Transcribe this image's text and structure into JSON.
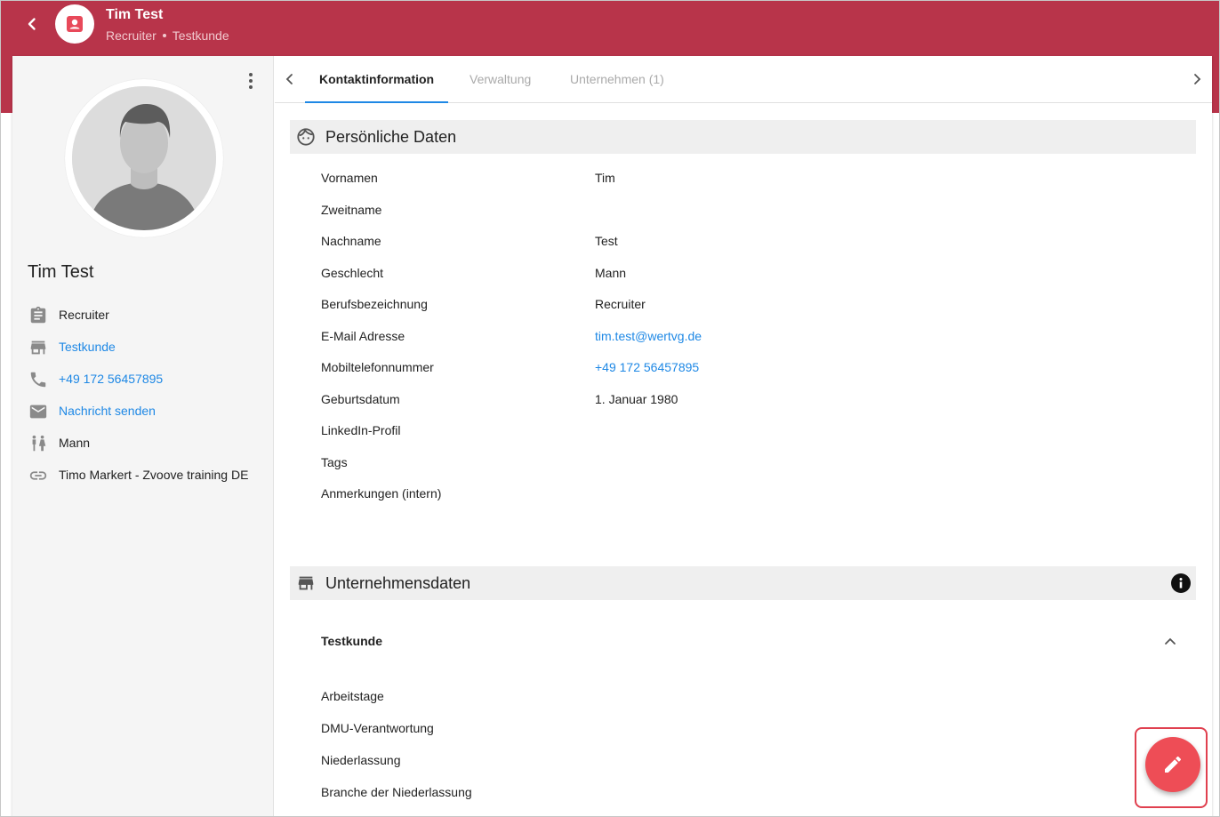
{
  "header": {
    "title": "Tim Test",
    "subtitle_role": "Recruiter",
    "subtitle_company": "Testkunde"
  },
  "sidebar": {
    "name": "Tim Test",
    "items": [
      {
        "icon": "clipboard-icon",
        "label": "Recruiter",
        "link": false
      },
      {
        "icon": "store-icon",
        "label": "Testkunde",
        "link": true
      },
      {
        "icon": "phone-icon",
        "label": "+49 172 56457895",
        "link": true
      },
      {
        "icon": "mail-icon",
        "label": "Nachricht senden",
        "link": true
      },
      {
        "icon": "gender-icon",
        "label": "Mann",
        "link": false
      },
      {
        "icon": "link-icon",
        "label": "Timo Markert - Zvoove training DE",
        "link": false
      }
    ]
  },
  "tabs": [
    {
      "label": "Kontaktinformation",
      "active": true
    },
    {
      "label": "Verwaltung",
      "active": false
    },
    {
      "label": "Unternehmen (1)",
      "active": false
    }
  ],
  "personal": {
    "title": "Persönliche Daten",
    "fields": [
      {
        "label": "Vornamen",
        "value": "Tim"
      },
      {
        "label": "Zweitname",
        "value": ""
      },
      {
        "label": "Nachname",
        "value": "Test"
      },
      {
        "label": "Geschlecht",
        "value": "Mann"
      },
      {
        "label": "Berufsbezeichnung",
        "value": "Recruiter"
      },
      {
        "label": "E-Mail Adresse",
        "value": "tim.test@wertvg.de"
      },
      {
        "label": "Mobiltelefonnummer",
        "value": "+49 172 56457895"
      },
      {
        "label": "Geburtsdatum",
        "value": "1. Januar 1980"
      },
      {
        "label": "LinkedIn-Profil",
        "value": ""
      },
      {
        "label": "Tags",
        "value": ""
      },
      {
        "label": "Anmerkungen (intern)",
        "value": ""
      }
    ]
  },
  "company": {
    "title": "Unternehmensdaten",
    "name": "Testkunde",
    "fields": [
      {
        "label": "Arbeitstage"
      },
      {
        "label": "DMU-Verantwortung"
      },
      {
        "label": "Niederlassung"
      },
      {
        "label": "Branche der Niederlassung"
      }
    ]
  },
  "colors": {
    "brand": "#b8344a",
    "link": "#1e88e5",
    "fab": "#ee4d56"
  }
}
